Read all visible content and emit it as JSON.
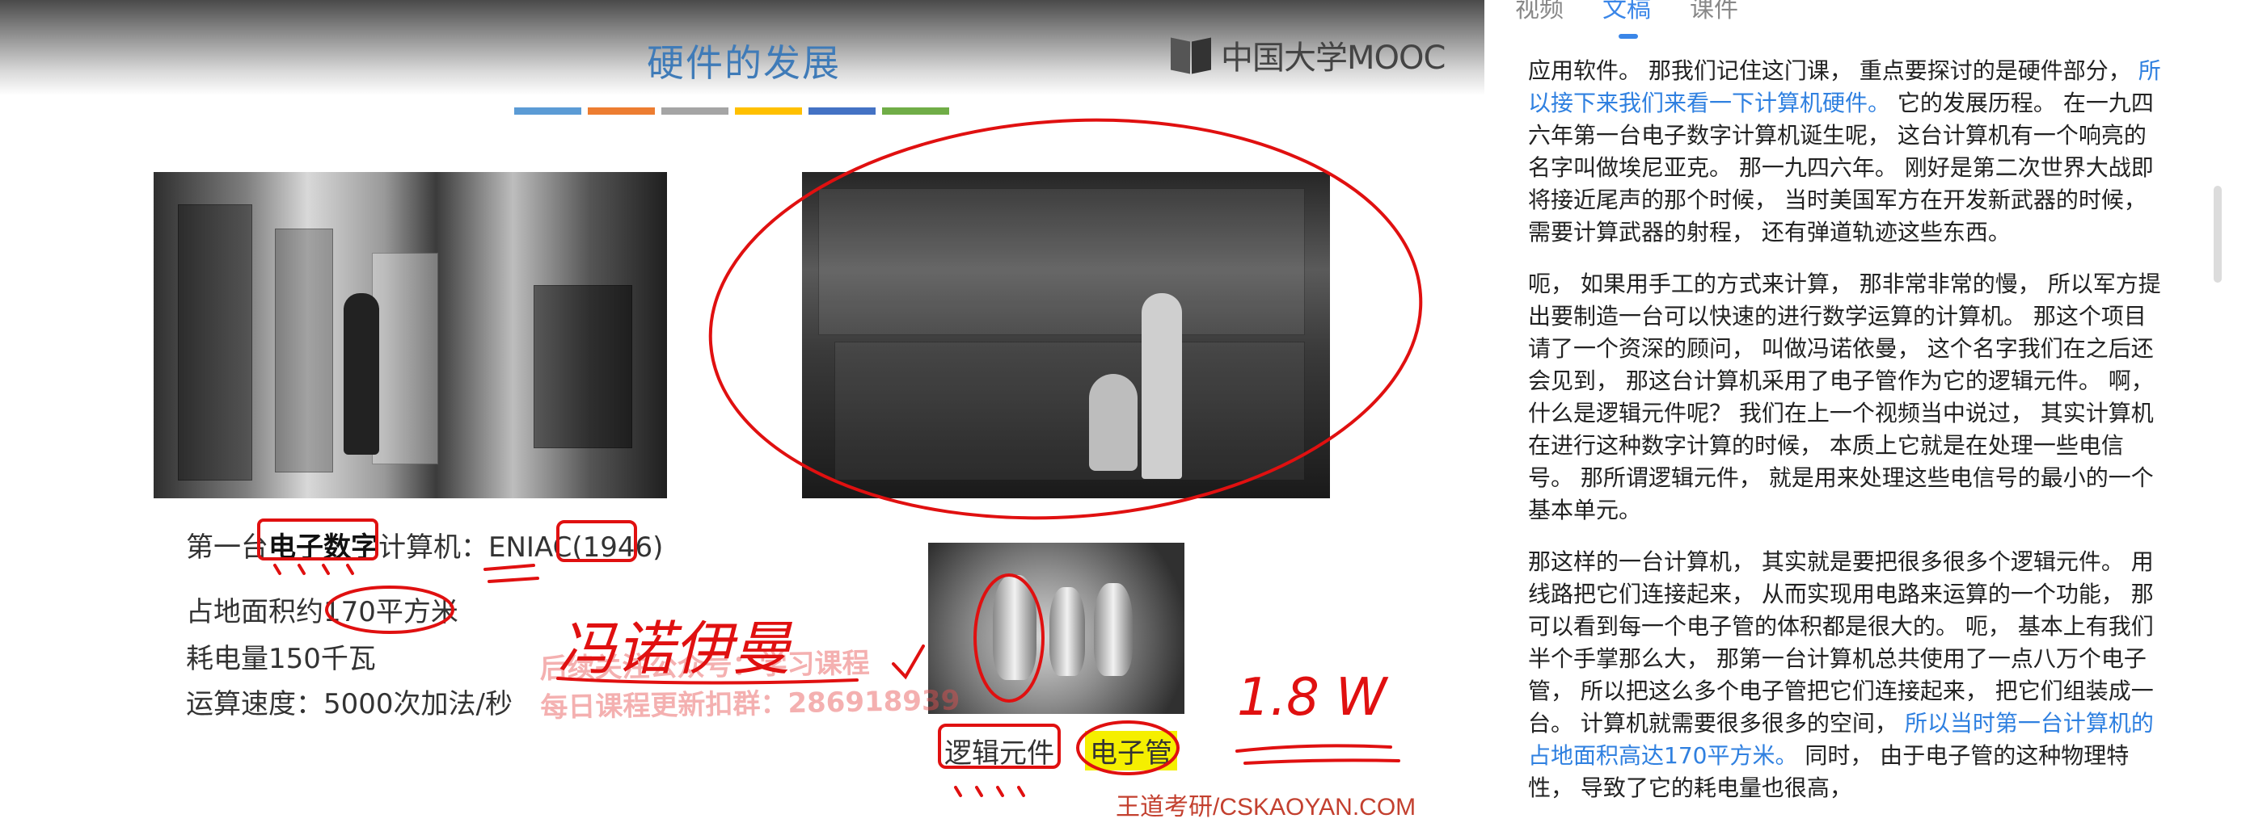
{
  "slide": {
    "title": "硬件的发展",
    "logo_text": "中国大学MOOC",
    "color_bar": [
      "#5b9bd5",
      "#ed7d31",
      "#a5a5a5",
      "#ffc000",
      "#4472c4",
      "#70ad47"
    ],
    "facts": {
      "line1_prefix": "第一台",
      "line1_highlight": "电子数字",
      "line1_middle": "计算机：ENIAC",
      "line1_year": "(1946)",
      "line2_prefix": "占地面积约",
      "line2_highlight": "170平方米",
      "line3": "耗电量150千瓦",
      "line4": "运算速度：5000次加法/秒"
    },
    "caption_logic": "逻辑元件",
    "caption_tube": "电子管",
    "watermark_line1": "后续关注公众号：学习课程",
    "watermark_line2": "每日课程更新扣群：286918939",
    "footer": "王道考研/CSKAOYAN.COM",
    "handwriting_name": "冯诺伊曼",
    "handwriting_power": "1.8 W"
  },
  "panel": {
    "tabs": [
      {
        "label": "视频",
        "active": false
      },
      {
        "label": "文稿",
        "active": true
      },
      {
        "label": "课件",
        "active": false
      }
    ],
    "paragraphs": [
      [
        {
          "text": "应用软件。 那我们记住这门课， 重点要探讨的是硬件部分， ",
          "blue": false
        },
        {
          "text": "所以接下来我们来看一下计算机硬件。",
          "blue": true
        },
        {
          "text": " 它的发展历程。 在一九四六年第一台电子数字计算机诞生呢， 这台计算机有一个响亮的名字叫做埃尼亚克。 那一九四六年。 刚好是第二次世界大战即将接近尾声的那个时候， 当时美国军方在开发新武器的时候， 需要计算武器的射程， 还有弹道轨迹这些东西。",
          "blue": false
        }
      ],
      [
        {
          "text": "呃， 如果用手工的方式来计算， 那非常非常的慢， 所以军方提出要制造一台可以快速的进行数学运算的计算机。 那这个项目请了一个资深的顾问， 叫做冯诺依曼， 这个名字我们在之后还会见到， 那这台计算机采用了电子管作为它的逻辑元件。 啊， 什么是逻辑元件呢？ 我们在上一个视频当中说过， 其实计算机在进行这种数字计算的时候， 本质上它就是在处理一些电信号。 那所谓逻辑元件， 就是用来处理这些电信号的最小的一个基本单元。",
          "blue": false
        }
      ],
      [
        {
          "text": "那这样的一台计算机， 其实就是要把很多很多个逻辑元件。 用线路把它们连接起来， 从而实现用电路来运算的一个功能， 那可以看到每一个电子管的体积都是很大的。 呃， 基本上有我们半个手掌那么大， 那第一台计算机总共使用了一点八万个电子管， 所以把这么多个电子管把它们连接起来， 把它们组装成一台。 计算机就需要很多很多的空间， ",
          "blue": false
        },
        {
          "text": "所以当时第一台计算机的占地面积高达170平方米。",
          "blue": true
        },
        {
          "text": " 同时， 由于电子管的这种物理特性， 导致了它的耗电量也很高，",
          "blue": false
        }
      ]
    ]
  }
}
